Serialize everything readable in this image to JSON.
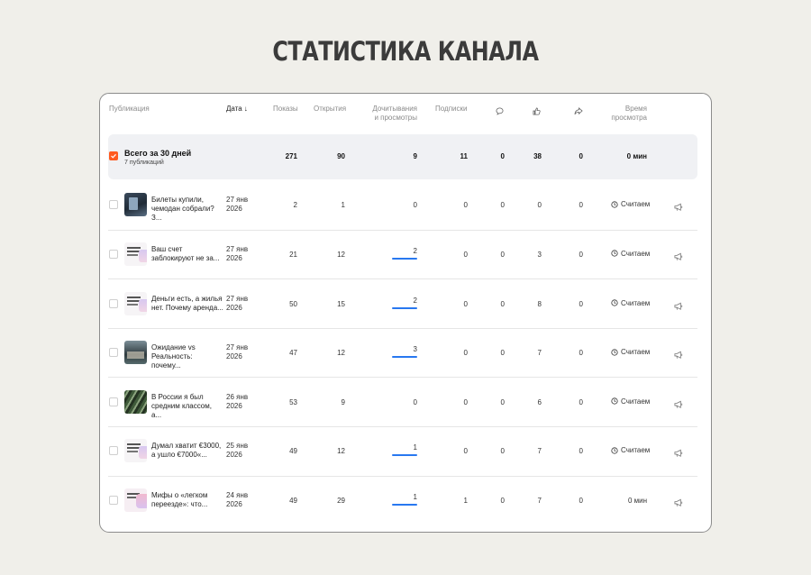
{
  "page_title": "СТАТИСТИКА КАНАЛА",
  "headers": {
    "publication": "Публикация",
    "date": "Дата",
    "date_sort_arrow": "↓",
    "views": "Показы",
    "opens": "Открытия",
    "reads_line1": "Дочитывания",
    "reads_line2": "и просмотры",
    "subs": "Подписки",
    "comments_icon": "comment-icon",
    "likes_icon": "like-icon",
    "shares_icon": "share-icon",
    "time_line1": "Время",
    "time_line2": "просмотра"
  },
  "total": {
    "title": "Всего за 30 дней",
    "subtitle": "7 публикаций",
    "views": "271",
    "opens": "90",
    "reads": "9",
    "subs": "11",
    "comments": "0",
    "likes": "38",
    "shares": "0",
    "time": "0 мин"
  },
  "rows": [
    {
      "title": "Билеты купили, чемодан собрали? З...",
      "date1": "27 янв",
      "date2": "2026",
      "views": "2",
      "opens": "1",
      "reads": "0",
      "reads_fill": 0,
      "subs": "0",
      "comments": "0",
      "likes": "0",
      "shares": "0",
      "time": "Считаем",
      "thumb": "photo-dark"
    },
    {
      "title": "Ваш счет заблокируют не за...",
      "date1": "27 янв",
      "date2": "2026",
      "views": "21",
      "opens": "12",
      "reads": "2",
      "reads_fill": 1,
      "subs": "0",
      "comments": "0",
      "likes": "3",
      "shares": "0",
      "time": "Считаем",
      "thumb": "text-card"
    },
    {
      "title": "Деньги есть, а жилья нет. Почему арендa...",
      "date1": "27 янв",
      "date2": "2026",
      "views": "50",
      "opens": "15",
      "reads": "2",
      "reads_fill": 1,
      "subs": "0",
      "comments": "0",
      "likes": "8",
      "shares": "0",
      "time": "Считаем",
      "thumb": "text-card"
    },
    {
      "title": "Ожидание vs Реальность: почему...",
      "date1": "27 янв",
      "date2": "2026",
      "views": "47",
      "opens": "12",
      "reads": "3",
      "reads_fill": 1,
      "subs": "0",
      "comments": "0",
      "likes": "7",
      "shares": "0",
      "time": "Считаем",
      "thumb": "photo-street"
    },
    {
      "title": "В России я был средним классом, а...",
      "date1": "26 янв",
      "date2": "2026",
      "views": "53",
      "opens": "9",
      "reads": "0",
      "reads_fill": 0,
      "subs": "0",
      "comments": "0",
      "likes": "6",
      "shares": "0",
      "time": "Считаем",
      "thumb": "photo-green"
    },
    {
      "title": "Думал хватит €3000, а ушло €7000«...",
      "date1": "25 янв",
      "date2": "2026",
      "views": "49",
      "opens": "12",
      "reads": "1",
      "reads_fill": 1,
      "subs": "0",
      "comments": "0",
      "likes": "7",
      "shares": "0",
      "time": "Считаем",
      "thumb": "text-card"
    },
    {
      "title": "Мифы о «легком переезде»: что...",
      "date1": "24 янв",
      "date2": "2026",
      "views": "49",
      "opens": "29",
      "reads": "1",
      "reads_fill": 1,
      "subs": "1",
      "comments": "0",
      "likes": "7",
      "shares": "0",
      "time": "0 мин",
      "thumb": "text-card-pink"
    }
  ],
  "colors": {
    "accent": "#ff5a1f",
    "progress": "#2878f0",
    "background": "#f0efea"
  }
}
